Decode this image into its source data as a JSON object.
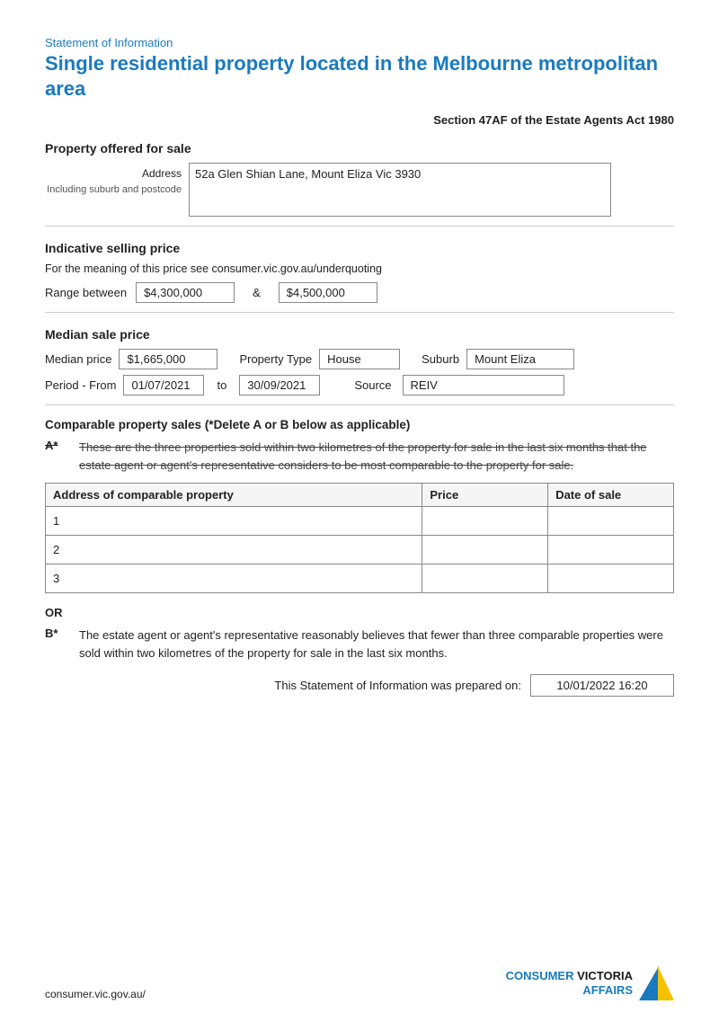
{
  "header": {
    "subtitle": "Statement of Information",
    "title": "Single residential property located in the Melbourne metropolitan area"
  },
  "act": {
    "text": "Section 47AF of the Estate Agents Act 1980"
  },
  "property_offered": {
    "heading": "Property offered for sale",
    "address_label": "Address",
    "address_sublabel": "Including suburb and postcode",
    "address_value": "52a Glen Shian Lane, Mount Eliza Vic 3930"
  },
  "indicative": {
    "heading": "Indicative selling price",
    "note": "For the meaning of this price see consumer.vic.gov.au/underquoting",
    "range_label": "Range between",
    "ampersand": "&",
    "low": "$4,300,000",
    "high": "$4,500,000"
  },
  "median": {
    "heading": "Median sale price",
    "median_price_label": "Median price",
    "median_price_value": "$1,665,000",
    "property_type_label": "Property Type",
    "property_type_value": "House",
    "suburb_label": "Suburb",
    "suburb_value": "Mount Eliza",
    "period_from_label": "Period - From",
    "period_from_value": "01/07/2021",
    "to_label": "to",
    "period_to_value": "30/09/2021",
    "source_label": "Source",
    "source_value": "REIV"
  },
  "comparable": {
    "heading": "Comparable property sales (*Delete A or B below as applicable)",
    "point_a_label": "A*",
    "point_a_text": "These are the three properties sold within two kilometres of the property for sale in the last six months that the estate agent or agent's representative considers to be most comparable to the property for sale.",
    "table": {
      "col1": "Address of comparable property",
      "col2": "Price",
      "col3": "Date of sale",
      "rows": [
        {
          "num": "1",
          "address": "",
          "price": "",
          "date": ""
        },
        {
          "num": "2",
          "address": "",
          "price": "",
          "date": ""
        },
        {
          "num": "3",
          "address": "",
          "price": "",
          "date": ""
        }
      ]
    },
    "or_label": "OR",
    "point_b_label": "B*",
    "point_b_text": "The estate agent or agent's representative reasonably believes that fewer than three comparable properties were sold within two kilometres of the property for sale in the last six months."
  },
  "prepared": {
    "label": "This Statement of Information was prepared on:",
    "value": "10/01/2022 16:20"
  },
  "footer": {
    "url": "consumer.vic.gov.au/",
    "logo_consumer": "CONSUMER",
    "logo_affairs": "AFFAIRS",
    "logo_victoria": "VICTORIA"
  }
}
